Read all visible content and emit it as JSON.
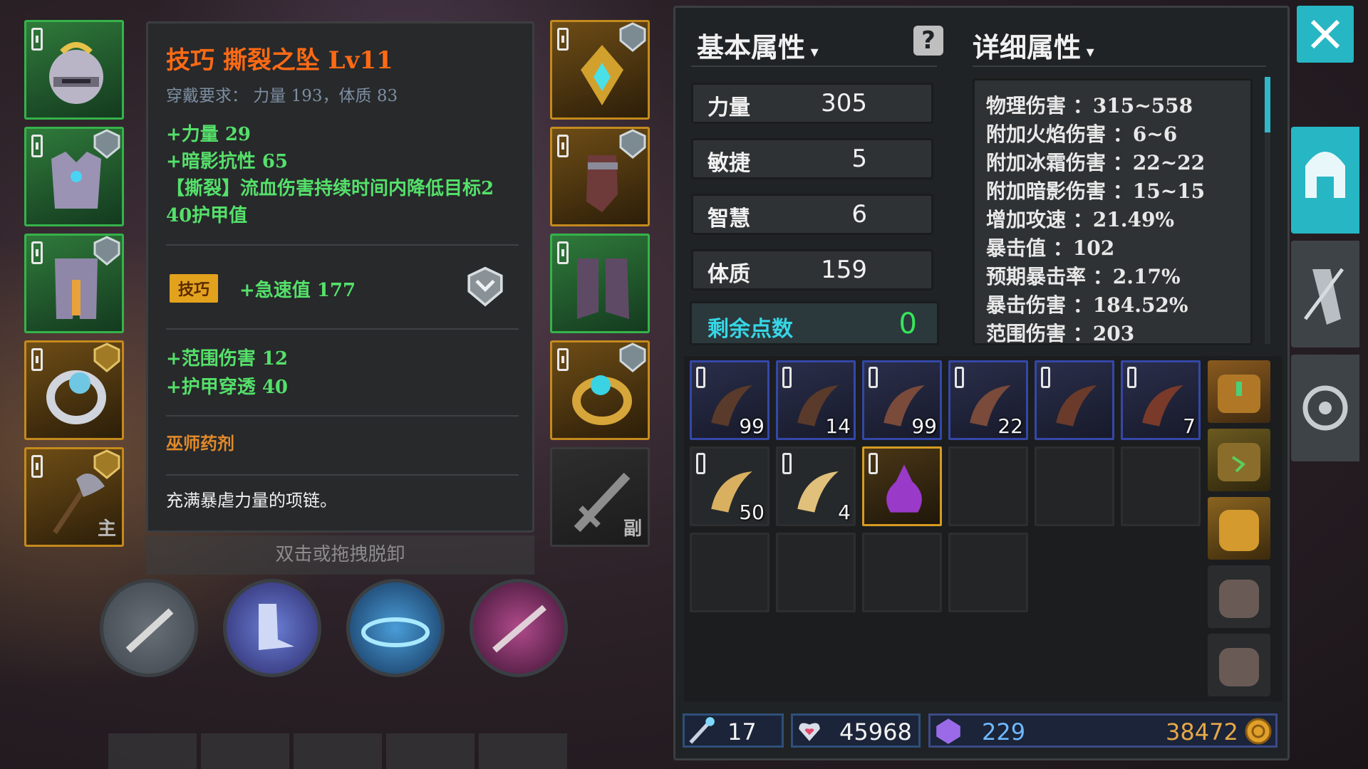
{
  "tooltip": {
    "title": "技巧 撕裂之坠 Lv11",
    "requirement": "穿戴要求： 力量 193，体质 83",
    "stats": [
      "+力量 29",
      "+暗影抗性 65",
      "【撕裂】流血伤害持续时间内降低目标2",
      "40护甲值"
    ],
    "tag": "技巧",
    "tag_stat": "+急速值 177",
    "extra_stats": [
      "+范围伤害 12",
      "+护甲穿透 40"
    ],
    "category": "巫师药剂",
    "description": "充满暴虐力量的项链。"
  },
  "hint": "双击或拖拽脱卸",
  "left_slots": [
    {
      "name": "helmet-slot",
      "label": ""
    },
    {
      "name": "chest-armor-slot",
      "label": ""
    },
    {
      "name": "leg-armor-slot",
      "label": ""
    },
    {
      "name": "ring-slot",
      "label": ""
    },
    {
      "name": "main-weapon-slot",
      "label": "主"
    }
  ],
  "right_slots": [
    {
      "name": "necklace-slot",
      "label": ""
    },
    {
      "name": "gloves-slot",
      "label": ""
    },
    {
      "name": "boots-slot",
      "label": ""
    },
    {
      "name": "ring2-slot",
      "label": ""
    },
    {
      "name": "offhand-weapon-slot",
      "label": "副"
    }
  ],
  "headers": {
    "basic": "基本属性",
    "detail": "详细属性"
  },
  "help_label": "?",
  "attributes": [
    {
      "name": "力量",
      "value": "305"
    },
    {
      "name": "敏捷",
      "value": "5"
    },
    {
      "name": "智慧",
      "value": "6"
    },
    {
      "name": "体质",
      "value": "159"
    }
  ],
  "remaining": {
    "label": "剩余点数",
    "value": "0"
  },
  "details": [
    "物理伤害 ：315~558",
    "附加火焰伤害 ：6~6",
    "附加冰霜伤害 ：22~22",
    "附加暗影伤害 ：15~15",
    "增加攻速 ：21.49%",
    "暴击值 ：102",
    "预期暴击率 ：2.17%",
    "暴击伤害 ：184.52%",
    "范围伤害 ：203"
  ],
  "inventory": [
    {
      "name": "horn-item",
      "count": "99",
      "style": "b"
    },
    {
      "name": "horn-item",
      "count": "14",
      "style": "b"
    },
    {
      "name": "claw-branch-item",
      "count": "99",
      "style": "b"
    },
    {
      "name": "claw-branch-item",
      "count": "22",
      "style": "b"
    },
    {
      "name": "tail-item",
      "count": "",
      "style": "b"
    },
    {
      "name": "beast-paw-item",
      "count": "7",
      "style": "b"
    },
    {
      "name": "scroll-item",
      "count": "50",
      "style": "s"
    },
    {
      "name": "rolled-scroll-item",
      "count": "4",
      "style": "s"
    },
    {
      "name": "purple-potion-item",
      "count": "",
      "style": "gold"
    },
    {
      "name": "empty-slot",
      "count": "",
      "style": "e"
    },
    {
      "name": "empty-slot",
      "count": "",
      "style": "e"
    },
    {
      "name": "empty-slot",
      "count": "",
      "style": "e"
    },
    {
      "name": "empty-slot",
      "count": "",
      "style": "e"
    },
    {
      "name": "empty-slot",
      "count": "",
      "style": "e"
    },
    {
      "name": "empty-slot",
      "count": "",
      "style": "e"
    },
    {
      "name": "empty-slot",
      "count": "",
      "style": "e"
    }
  ],
  "currency": {
    "keys": "17",
    "hearts": "45968",
    "gems": "229",
    "gold": "38472"
  }
}
